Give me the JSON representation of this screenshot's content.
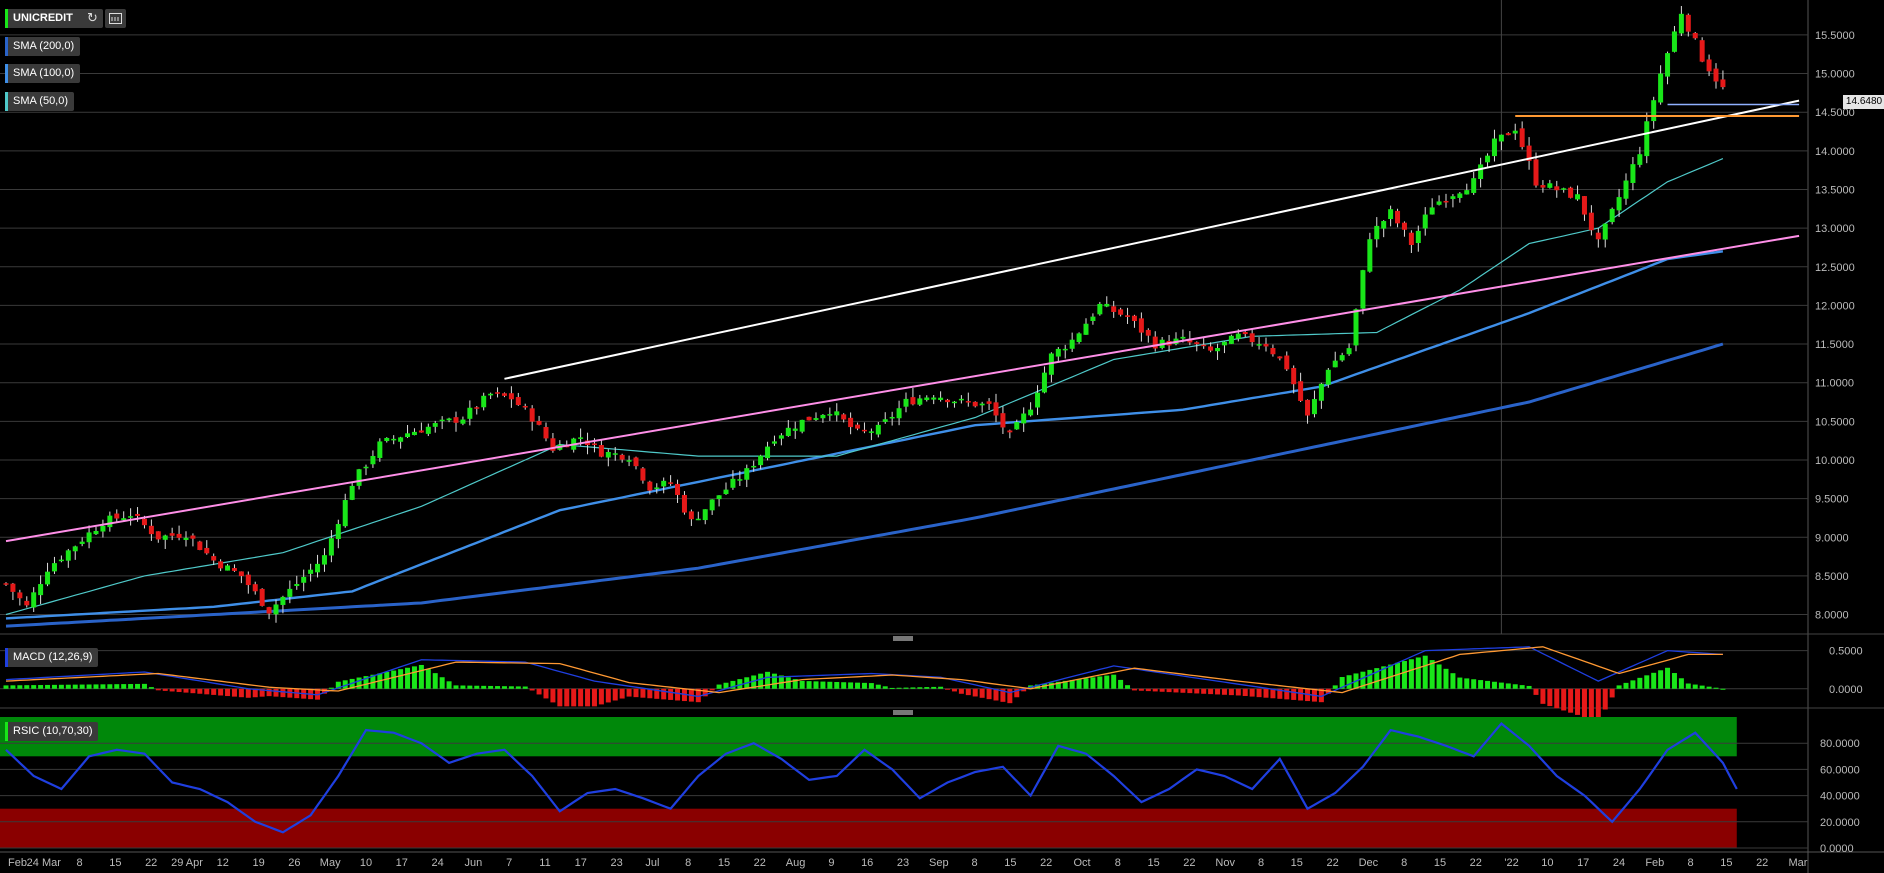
{
  "toolbar": {
    "instrument_label": "UNICREDIT",
    "refresh_icon": "refresh-icon",
    "settings_icon": "calculator-icon"
  },
  "legend": {
    "sma200": "SMA (200,0)",
    "sma100": "SMA (100,0)",
    "sma50": "SMA (50,0)",
    "macd": "MACD (12,26,9)",
    "rsic": "RSIC (10,70,30)"
  },
  "colors": {
    "background": "#000000",
    "candle_up": "#19e619",
    "candle_down": "#e61919",
    "sma200": "#2a63c9",
    "sma100": "#3f8fe8",
    "sma50": "#4fc9c9",
    "resistance_line": "#ffffff",
    "support_line": "#ff8fe8",
    "horizontal_level": "#ff9933",
    "rsi_line": "#1f3fe0",
    "rsi_overbought_zone": "#00880a",
    "rsi_oversold_zone": "#8a0000",
    "macd_line": "#1f3fe0",
    "signal_line": "#ff9933"
  },
  "price_flag": "14.6480",
  "chart_data": [
    {
      "type": "candlestick",
      "title": "UNICREDIT",
      "y_ticks": [
        "8.0000",
        "8.5000",
        "9.0000",
        "9.5000",
        "10.0000",
        "10.5000",
        "11.0000",
        "11.5000",
        "12.0000",
        "12.5000",
        "13.0000",
        "13.5000",
        "14.0000",
        "14.5000",
        "15.0000",
        "15.5000"
      ],
      "ylim": [
        7.8,
        15.9
      ],
      "x_ticks": [
        "Feb",
        "24 Mar",
        "8",
        "15",
        "22",
        "29 Apr",
        "12",
        "19",
        "26",
        "May",
        "10",
        "17",
        "24",
        "Jun",
        "7",
        "11",
        "17",
        "23",
        "Jul",
        "8",
        "15",
        "22",
        "Aug",
        "9",
        "16",
        "23",
        "Sep",
        "8",
        "15",
        "22",
        "Oct",
        "8",
        "15",
        "22",
        "Nov",
        "8",
        "15",
        "22",
        "Dec",
        "8",
        "15",
        "22",
        "'22",
        "10",
        "17",
        "24",
        "Feb",
        "8",
        "15",
        "22",
        "Mar"
      ],
      "close_path_waypoints": [
        {
          "i": 0,
          "v": 8.4
        },
        {
          "i": 3,
          "v": 8.1
        },
        {
          "i": 6,
          "v": 8.6
        },
        {
          "i": 10,
          "v": 8.9
        },
        {
          "i": 14,
          "v": 9.2
        },
        {
          "i": 18,
          "v": 9.3
        },
        {
          "i": 22,
          "v": 9.0
        },
        {
          "i": 26,
          "v": 9.05
        },
        {
          "i": 30,
          "v": 8.7
        },
        {
          "i": 34,
          "v": 8.5
        },
        {
          "i": 38,
          "v": 8.05
        },
        {
          "i": 42,
          "v": 8.4
        },
        {
          "i": 46,
          "v": 8.75
        },
        {
          "i": 50,
          "v": 9.7
        },
        {
          "i": 54,
          "v": 10.2
        },
        {
          "i": 58,
          "v": 10.35
        },
        {
          "i": 62,
          "v": 10.45
        },
        {
          "i": 66,
          "v": 10.55
        },
        {
          "i": 70,
          "v": 10.85
        },
        {
          "i": 73,
          "v": 10.8
        },
        {
          "i": 76,
          "v": 10.55
        },
        {
          "i": 79,
          "v": 10.15
        },
        {
          "i": 83,
          "v": 10.3
        },
        {
          "i": 86,
          "v": 10.1
        },
        {
          "i": 90,
          "v": 10.05
        },
        {
          "i": 93,
          "v": 9.65
        },
        {
          "i": 96,
          "v": 9.7
        },
        {
          "i": 99,
          "v": 9.2
        },
        {
          "i": 103,
          "v": 9.55
        },
        {
          "i": 107,
          "v": 9.85
        },
        {
          "i": 111,
          "v": 10.3
        },
        {
          "i": 115,
          "v": 10.5
        },
        {
          "i": 119,
          "v": 10.65
        },
        {
          "i": 123,
          "v": 10.35
        },
        {
          "i": 126,
          "v": 10.4
        },
        {
          "i": 130,
          "v": 10.75
        },
        {
          "i": 134,
          "v": 10.85
        },
        {
          "i": 138,
          "v": 10.75
        },
        {
          "i": 142,
          "v": 10.7
        },
        {
          "i": 145,
          "v": 10.3
        },
        {
          "i": 148,
          "v": 10.7
        },
        {
          "i": 151,
          "v": 11.35
        },
        {
          "i": 154,
          "v": 11.55
        },
        {
          "i": 158,
          "v": 12.0
        },
        {
          "i": 162,
          "v": 11.85
        },
        {
          "i": 166,
          "v": 11.5
        },
        {
          "i": 170,
          "v": 11.55
        },
        {
          "i": 174,
          "v": 11.4
        },
        {
          "i": 178,
          "v": 11.6
        },
        {
          "i": 182,
          "v": 11.5
        },
        {
          "i": 185,
          "v": 11.2
        },
        {
          "i": 188,
          "v": 10.55
        },
        {
          "i": 191,
          "v": 11.2
        },
        {
          "i": 194,
          "v": 11.45
        },
        {
          "i": 197,
          "v": 12.9
        },
        {
          "i": 200,
          "v": 13.2
        },
        {
          "i": 203,
          "v": 12.8
        },
        {
          "i": 206,
          "v": 13.3
        },
        {
          "i": 209,
          "v": 13.45
        },
        {
          "i": 212,
          "v": 13.6
        },
        {
          "i": 215,
          "v": 14.1
        },
        {
          "i": 218,
          "v": 14.3
        },
        {
          "i": 221,
          "v": 13.6
        },
        {
          "i": 224,
          "v": 13.5
        },
        {
          "i": 227,
          "v": 13.4
        },
        {
          "i": 230,
          "v": 12.8
        },
        {
          "i": 233,
          "v": 13.4
        },
        {
          "i": 236,
          "v": 14.0
        },
        {
          "i": 239,
          "v": 15.0
        },
        {
          "i": 242,
          "v": 15.8
        },
        {
          "i": 245,
          "v": 15.2
        },
        {
          "i": 248,
          "v": 14.8
        }
      ],
      "count": 249,
      "series": [
        {
          "name": "SMA (200,0)",
          "values": [
            [
              0,
              7.85
            ],
            [
              60,
              8.15
            ],
            [
              100,
              8.6
            ],
            [
              140,
              9.25
            ],
            [
              180,
              10.0
            ],
            [
              220,
              10.75
            ],
            [
              248,
              11.5
            ]
          ]
        },
        {
          "name": "SMA (100,0)",
          "values": [
            [
              0,
              7.95
            ],
            [
              30,
              8.1
            ],
            [
              50,
              8.3
            ],
            [
              80,
              9.35
            ],
            [
              110,
              9.9
            ],
            [
              140,
              10.45
            ],
            [
              170,
              10.65
            ],
            [
              190,
              10.95
            ],
            [
              220,
              11.9
            ],
            [
              240,
              12.6
            ],
            [
              248,
              12.7
            ]
          ]
        },
        {
          "name": "SMA (50,0)",
          "values": [
            [
              0,
              8.0
            ],
            [
              20,
              8.5
            ],
            [
              40,
              8.8
            ],
            [
              60,
              9.4
            ],
            [
              80,
              10.2
            ],
            [
              100,
              10.05
            ],
            [
              120,
              10.05
            ],
            [
              140,
              10.55
            ],
            [
              160,
              11.3
            ],
            [
              180,
              11.6
            ],
            [
              198,
              11.65
            ],
            [
              210,
              12.2
            ],
            [
              220,
              12.8
            ],
            [
              230,
              13.0
            ],
            [
              240,
              13.6
            ],
            [
              248,
              13.9
            ]
          ]
        }
      ],
      "trendlines": [
        {
          "name": "resistance",
          "from": [
            72,
            11.05
          ],
          "to": [
            259,
            14.65
          ]
        },
        {
          "name": "support",
          "from": [
            0,
            8.95
          ],
          "to": [
            259,
            12.9
          ]
        },
        {
          "name": "level",
          "from": [
            218,
            14.45
          ],
          "to": [
            259,
            14.45
          ]
        },
        {
          "name": "last",
          "from": [
            240,
            14.6
          ],
          "to": [
            259,
            14.6
          ]
        }
      ],
      "vertical_marker_index": 216
    },
    {
      "type": "macd",
      "title": "MACD (12,26,9)",
      "y_ticks": [
        "0.0000",
        "0.5000"
      ],
      "ylim": [
        -0.2,
        0.6
      ],
      "macd_waypoints": [
        [
          0,
          0.12
        ],
        [
          20,
          0.22
        ],
        [
          35,
          0.0
        ],
        [
          45,
          -0.08
        ],
        [
          60,
          0.38
        ],
        [
          75,
          0.35
        ],
        [
          85,
          0.1
        ],
        [
          100,
          -0.1
        ],
        [
          110,
          0.15
        ],
        [
          125,
          0.2
        ],
        [
          135,
          0.15
        ],
        [
          145,
          -0.05
        ],
        [
          160,
          0.3
        ],
        [
          175,
          0.1
        ],
        [
          190,
          -0.1
        ],
        [
          205,
          0.5
        ],
        [
          220,
          0.55
        ],
        [
          230,
          0.1
        ],
        [
          240,
          0.5
        ],
        [
          248,
          0.45
        ]
      ],
      "signal_waypoints": [
        [
          0,
          0.1
        ],
        [
          22,
          0.2
        ],
        [
          38,
          0.02
        ],
        [
          48,
          -0.03
        ],
        [
          65,
          0.35
        ],
        [
          80,
          0.33
        ],
        [
          90,
          0.08
        ],
        [
          103,
          -0.05
        ],
        [
          115,
          0.12
        ],
        [
          128,
          0.18
        ],
        [
          138,
          0.12
        ],
        [
          148,
          0.0
        ],
        [
          163,
          0.27
        ],
        [
          178,
          0.1
        ],
        [
          193,
          -0.05
        ],
        [
          210,
          0.45
        ],
        [
          222,
          0.55
        ],
        [
          233,
          0.2
        ],
        [
          243,
          0.45
        ],
        [
          248,
          0.45
        ]
      ]
    },
    {
      "type": "rsi",
      "title": "RSIC (10,70,30)",
      "y_ticks": [
        "0.0000",
        "20.0000",
        "40.0000",
        "60.0000",
        "80.0000"
      ],
      "ylim": [
        0,
        100
      ],
      "overbought": 70,
      "oversold": 30,
      "rsi_waypoints": [
        [
          0,
          75
        ],
        [
          4,
          55
        ],
        [
          8,
          45
        ],
        [
          12,
          70
        ],
        [
          16,
          75
        ],
        [
          20,
          72
        ],
        [
          24,
          50
        ],
        [
          28,
          45
        ],
        [
          32,
          35
        ],
        [
          36,
          20
        ],
        [
          40,
          12
        ],
        [
          44,
          25
        ],
        [
          48,
          55
        ],
        [
          52,
          90
        ],
        [
          56,
          88
        ],
        [
          60,
          80
        ],
        [
          64,
          65
        ],
        [
          68,
          72
        ],
        [
          72,
          75
        ],
        [
          76,
          55
        ],
        [
          80,
          28
        ],
        [
          84,
          42
        ],
        [
          88,
          45
        ],
        [
          92,
          38
        ],
        [
          96,
          30
        ],
        [
          100,
          55
        ],
        [
          104,
          72
        ],
        [
          108,
          80
        ],
        [
          112,
          68
        ],
        [
          116,
          52
        ],
        [
          120,
          55
        ],
        [
          124,
          75
        ],
        [
          128,
          60
        ],
        [
          132,
          38
        ],
        [
          136,
          50
        ],
        [
          140,
          58
        ],
        [
          144,
          62
        ],
        [
          148,
          40
        ],
        [
          152,
          78
        ],
        [
          156,
          72
        ],
        [
          160,
          55
        ],
        [
          164,
          35
        ],
        [
          168,
          45
        ],
        [
          172,
          60
        ],
        [
          176,
          55
        ],
        [
          180,
          45
        ],
        [
          184,
          68
        ],
        [
          188,
          30
        ],
        [
          192,
          42
        ],
        [
          196,
          62
        ],
        [
          200,
          90
        ],
        [
          204,
          85
        ],
        [
          208,
          78
        ],
        [
          212,
          70
        ],
        [
          216,
          95
        ],
        [
          220,
          78
        ],
        [
          224,
          55
        ],
        [
          228,
          40
        ],
        [
          232,
          20
        ],
        [
          236,
          45
        ],
        [
          240,
          75
        ],
        [
          244,
          88
        ],
        [
          248,
          65
        ],
        [
          250,
          45
        ]
      ]
    }
  ]
}
